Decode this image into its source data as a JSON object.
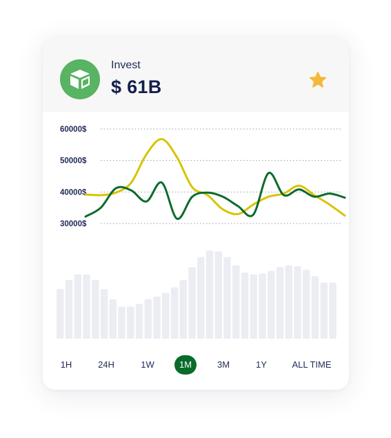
{
  "header": {
    "title": "Invest",
    "value": "$ 61B",
    "logo_icon": "neo-cube-icon",
    "favorite_icon": "star-icon",
    "logo_color": "#58b463",
    "star_color": "#f4b93a"
  },
  "chart_data": {
    "type": "line",
    "y_ticks": [
      "60000$",
      "50000$",
      "40000$",
      "30000$"
    ],
    "ylim": [
      30000,
      60000
    ],
    "grid": true,
    "series": [
      {
        "color": "#d8c300",
        "values": [
          39200,
          39000,
          39800,
          43000,
          52000,
          56800,
          51000,
          41500,
          39000,
          34500,
          33000,
          36000,
          38500,
          39500,
          42000,
          39000,
          36000,
          32500
        ]
      },
      {
        "color": "#0a6b2b",
        "values": [
          32200,
          35000,
          41200,
          40500,
          37000,
          43000,
          31500,
          38500,
          39800,
          38500,
          35500,
          32800,
          46000,
          39000,
          40800,
          38500,
          39500,
          38200
        ]
      }
    ],
    "volume_bars": [
      0.54,
      0.64,
      0.7,
      0.7,
      0.64,
      0.54,
      0.43,
      0.35,
      0.35,
      0.38,
      0.43,
      0.46,
      0.5,
      0.56,
      0.64,
      0.78,
      0.89,
      0.96,
      0.95,
      0.89,
      0.8,
      0.72,
      0.7,
      0.71,
      0.74,
      0.78,
      0.8,
      0.79,
      0.75,
      0.68,
      0.61,
      0.61
    ]
  },
  "time_ranges": {
    "options": [
      "1H",
      "24H",
      "1W",
      "1M",
      "3M",
      "1Y",
      "ALL TIME"
    ],
    "active": "1M"
  },
  "colors": {
    "active_range": "#0a6b2b",
    "bars": "#ebedf2",
    "grid": "#9a9ca3"
  }
}
